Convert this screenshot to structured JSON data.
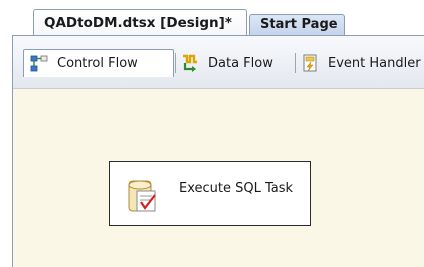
{
  "document_tabs": [
    {
      "label": "QADtoDM.dtsx [Design]*",
      "active": true
    },
    {
      "label": "Start Page",
      "active": false
    }
  ],
  "designer_tabs": [
    {
      "label": "Control Flow",
      "icon": "control-flow-icon",
      "active": true
    },
    {
      "label": "Data Flow",
      "icon": "data-flow-icon",
      "active": false
    },
    {
      "label": "Event Handler",
      "icon": "event-handler-icon",
      "active": false
    }
  ],
  "canvas": {
    "background": "#fbf7e6",
    "tasks": [
      {
        "label": "Execute SQL Task",
        "icon": "execute-sql-task-icon"
      }
    ]
  }
}
